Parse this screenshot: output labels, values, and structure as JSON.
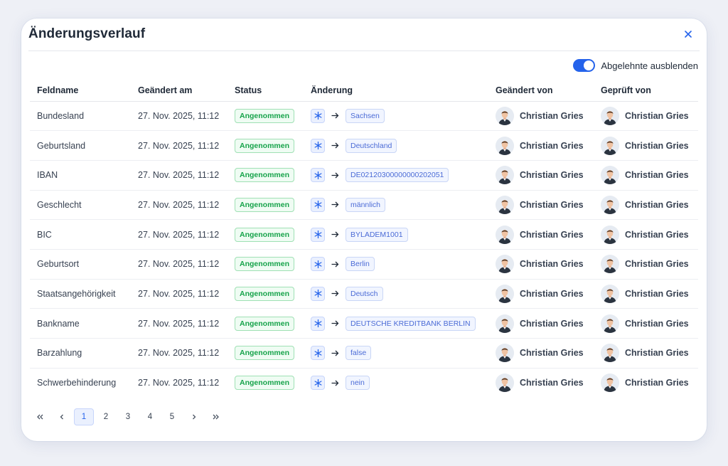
{
  "modal": {
    "title": "Änderungsverlauf",
    "close_label": "×"
  },
  "toggle": {
    "label": "Abgelehnte ausblenden",
    "on": true
  },
  "table": {
    "columns": [
      "Feldname",
      "Geändert am",
      "Status",
      "Änderung",
      "Geändert von",
      "Geprüft von"
    ],
    "rows": [
      {
        "field": "Bundesland",
        "date": "27. Nov. 2025, 11:12",
        "status": "Angenommen",
        "value": "Sachsen",
        "changed_by": "Christian Gries",
        "checked_by": "Christian Gries"
      },
      {
        "field": "Geburtsland",
        "date": "27. Nov. 2025, 11:12",
        "status": "Angenommen",
        "value": "Deutschland",
        "changed_by": "Christian Gries",
        "checked_by": "Christian Gries"
      },
      {
        "field": "IBAN",
        "date": "27. Nov. 2025, 11:12",
        "status": "Angenommen",
        "value": "DE02120300000000202051",
        "changed_by": "Christian Gries",
        "checked_by": "Christian Gries"
      },
      {
        "field": "Geschlecht",
        "date": "27. Nov. 2025, 11:12",
        "status": "Angenommen",
        "value": "männlich",
        "changed_by": "Christian Gries",
        "checked_by": "Christian Gries"
      },
      {
        "field": "BIC",
        "date": "27. Nov. 2025, 11:12",
        "status": "Angenommen",
        "value": "BYLADEM1001",
        "changed_by": "Christian Gries",
        "checked_by": "Christian Gries"
      },
      {
        "field": "Geburtsort",
        "date": "27. Nov. 2025, 11:12",
        "status": "Angenommen",
        "value": "Berlin",
        "changed_by": "Christian Gries",
        "checked_by": "Christian Gries"
      },
      {
        "field": "Staatsangehörigkeit",
        "date": "27. Nov. 2025, 11:12",
        "status": "Angenommen",
        "value": "Deutsch",
        "changed_by": "Christian Gries",
        "checked_by": "Christian Gries"
      },
      {
        "field": "Bankname",
        "date": "27. Nov. 2025, 11:12",
        "status": "Angenommen",
        "value": "DEUTSCHE KREDITBANK BERLIN",
        "changed_by": "Christian Gries",
        "checked_by": "Christian Gries"
      },
      {
        "field": "Barzahlung",
        "date": "27. Nov. 2025, 11:12",
        "status": "Angenommen",
        "value": "false",
        "changed_by": "Christian Gries",
        "checked_by": "Christian Gries"
      },
      {
        "field": "Schwerbehinderung",
        "date": "27. Nov. 2025, 11:12",
        "status": "Angenommen",
        "value": "nein",
        "changed_by": "Christian Gries",
        "checked_by": "Christian Gries"
      }
    ]
  },
  "pagination": {
    "first": "«",
    "prev": "‹",
    "pages": [
      "1",
      "2",
      "3",
      "4",
      "5"
    ],
    "current": "1",
    "next": "›",
    "last": "»"
  },
  "colors": {
    "accent": "#2563eb",
    "status_green": "#16a34a",
    "chip_blue": "#4b6bd6"
  },
  "icons": {
    "close": "close-icon",
    "change_marker": "asterisk-icon",
    "arrow": "arrow-right-icon",
    "avatar": "user-avatar"
  }
}
